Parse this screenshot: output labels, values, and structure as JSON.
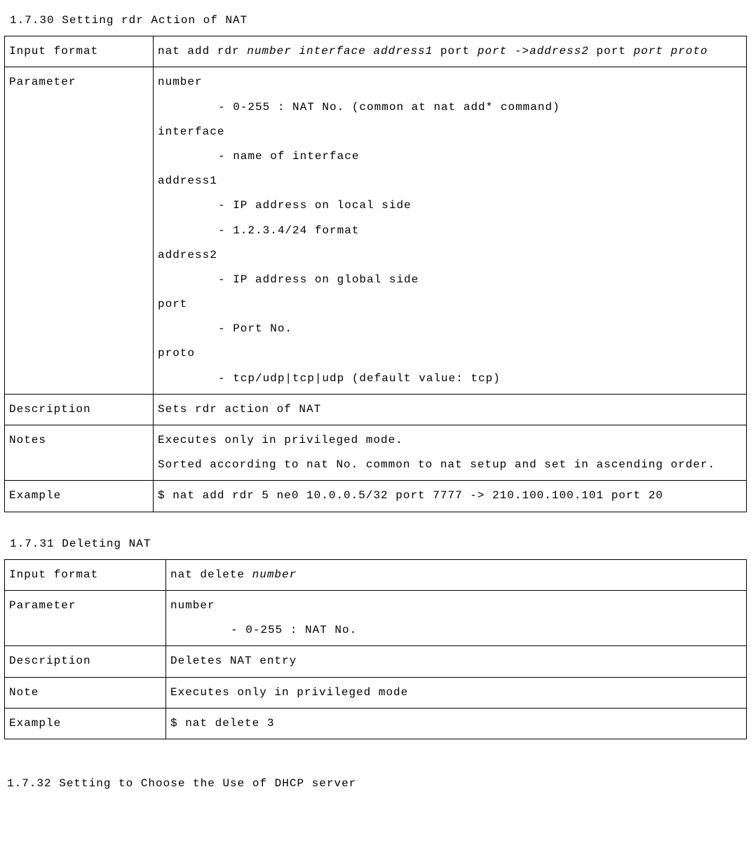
{
  "section_1_7_30": {
    "heading": "1.7.30 Setting rdr Action of NAT",
    "rows": {
      "input_format_label": "Input format",
      "input_format_pre": "nat add rdr ",
      "input_format_italic1": "number interface address1",
      "input_format_mid1": " port ",
      "input_format_italic2": "port",
      "input_format_mid2": " ->",
      "input_format_italic3": "address2",
      "input_format_mid3": " port ",
      "input_format_italic4": "port proto",
      "parameter_label": "Parameter",
      "param_number": "number",
      "param_number_d1": "- 0-255 : NAT No. (common at nat add* command)",
      "param_interface": "interface",
      "param_interface_d1": "- name of interface",
      "param_address1": "address1",
      "param_address1_d1": "- IP address on local side",
      "param_address1_d2": "- 1.2.3.4/24 format",
      "param_address2": "address2",
      "param_address2_d1": "- IP address on global side",
      "param_port": "port",
      "param_port_d1": "- Port No.",
      "param_proto": "proto",
      "param_proto_d1": "- tcp/udp|tcp|udp (default value: tcp)",
      "description_label": "Description",
      "description_value": "Sets rdr action of NAT",
      "notes_label": "Notes",
      "notes_line1": "Executes only in privileged mode.",
      "notes_line2": "Sorted according to nat No. common to nat setup and set in ascending order.",
      "example_label": "Example",
      "example_value": "$ nat add rdr 5 ne0 10.0.0.5/32 port 7777 -> 210.100.100.101 port 20"
    }
  },
  "section_1_7_31": {
    "heading": "1.7.31 Deleting NAT",
    "rows": {
      "input_format_label": "Input format",
      "input_format_pre": "nat delete ",
      "input_format_italic1": "number",
      "parameter_label": "Parameter",
      "param_number": "number",
      "param_number_d1": "- 0-255 : NAT No.",
      "description_label": "Description",
      "description_value": "Deletes NAT entry",
      "note_label": "Note",
      "note_value": "Executes only in privileged mode",
      "example_label": "Example",
      "example_value": "$ nat delete 3"
    }
  },
  "section_1_7_32": {
    "heading": "1.7.32 Setting to Choose the Use of DHCP server"
  }
}
